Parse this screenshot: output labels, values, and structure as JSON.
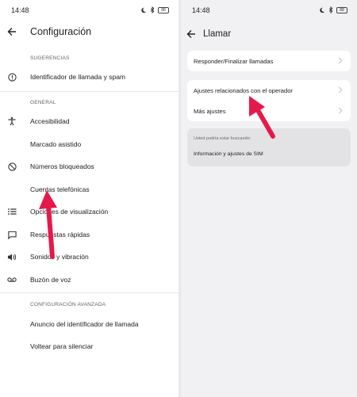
{
  "left": {
    "status": {
      "time": "14:48",
      "battery": "88"
    },
    "title": "Configuración",
    "sections": [
      {
        "header": "SUGERENCIAS",
        "items": [
          {
            "label": "Identificador de llamada y spam",
            "icon": "info-icon"
          }
        ]
      },
      {
        "header": "GENERAL",
        "items": [
          {
            "label": "Accesibilidad",
            "icon": "accessibility-icon"
          },
          {
            "label": "Marcado asistido",
            "icon": ""
          },
          {
            "label": "Números bloqueados",
            "icon": "block-icon"
          },
          {
            "label": "Cuentas telefónicas",
            "icon": ""
          },
          {
            "label": "Opciones de visualización",
            "icon": "list-icon"
          },
          {
            "label": "Respuestas rápidas",
            "icon": "chat-icon"
          },
          {
            "label": "Sonidos y vibración",
            "icon": "volume-icon"
          },
          {
            "label": "Buzón de voz",
            "icon": "voicemail-icon"
          }
        ]
      },
      {
        "header": "CONFIGURACIÓN AVANZADA",
        "items": [
          {
            "label": "Anuncio del identificador de llamada",
            "icon": ""
          },
          {
            "label": "Voltear para silenciar",
            "icon": ""
          }
        ]
      }
    ]
  },
  "right": {
    "status": {
      "time": "14:48",
      "battery": "88"
    },
    "title": "Llamar",
    "card1": [
      "Responder/Finalizar llamadas"
    ],
    "card2": [
      "Ajustes relacionados con el operador",
      "Más ajustes"
    ],
    "search": {
      "hint": "Usted podría estar buscando:",
      "result": "Información y ajustes de SIM"
    }
  },
  "colors": {
    "arrow": "#e6194b",
    "panel_bg": "#f1f1f3",
    "card_bg": "#ffffff",
    "search_bg": "#e3e3e5"
  }
}
